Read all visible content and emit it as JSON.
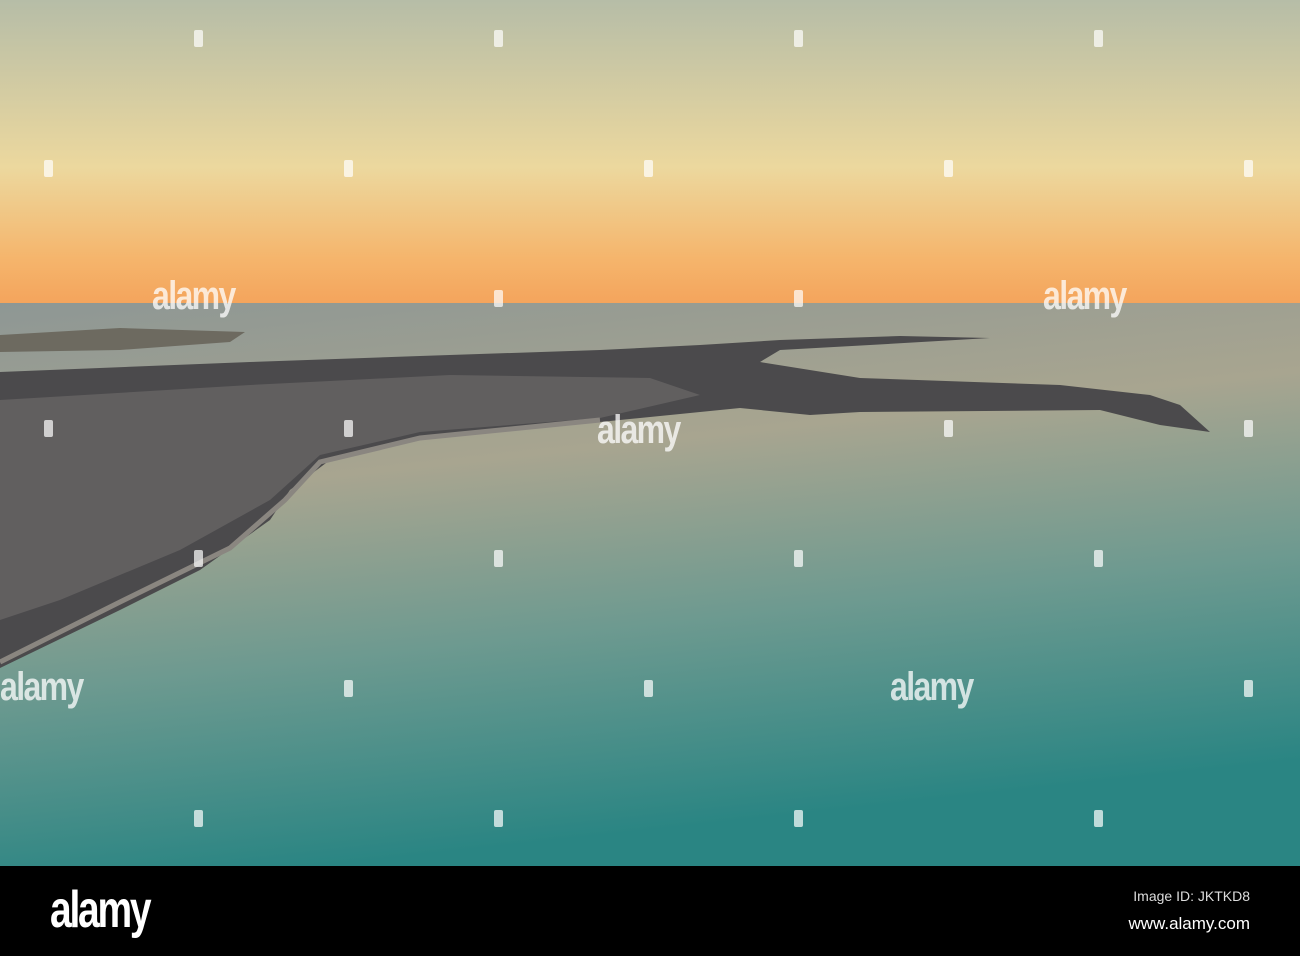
{
  "photo": {
    "subject": "aerial-coastline-sunset",
    "colors": {
      "sky_top": "#b8bea6",
      "sky_mid": "#efd99c",
      "horizon": "#f4a55e",
      "sea_far": "#8f9894",
      "sea_mid": "#a6a38e",
      "sea_near": "#2d8785",
      "land": "#4a4a4c"
    }
  },
  "watermark": {
    "text": "alamy"
  },
  "footer": {
    "logo": "alamy",
    "image_id": "Image ID: JKTKD8",
    "url": "www.alamy.com"
  }
}
